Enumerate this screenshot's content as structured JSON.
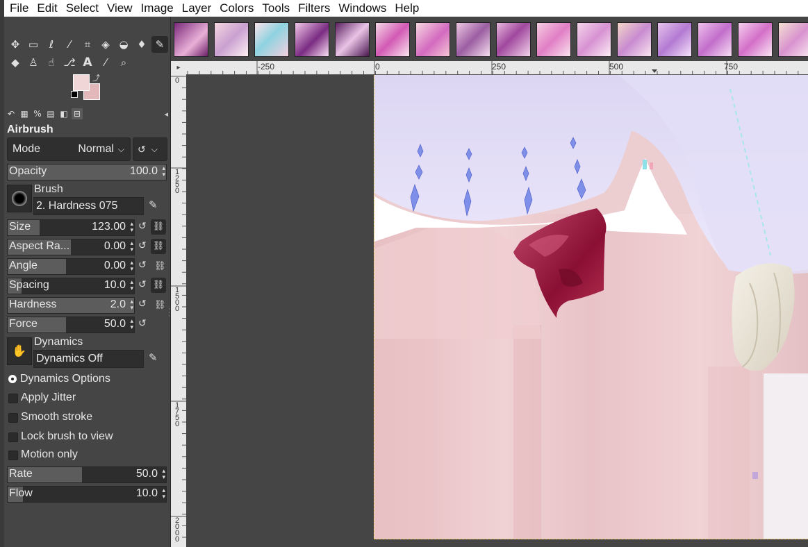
{
  "menubar": {
    "items": [
      "File",
      "Edit",
      "Select",
      "View",
      "Image",
      "Layer",
      "Colors",
      "Tools",
      "Filters",
      "Windows",
      "Help"
    ]
  },
  "toolbox": {
    "tools_row1": [
      "move-tool-icon",
      "rect-select-icon",
      "free-select-icon",
      "fuzzy-select-icon",
      "crop-icon",
      "transform-icon",
      "warp-icon",
      "bucket-fill-icon",
      "airbrush-icon"
    ],
    "tools_row2": [
      "eraser-icon",
      "clone-icon",
      "smudge-icon",
      "paths-icon",
      "text-icon",
      "color-picker-icon",
      "zoom-icon"
    ],
    "foreground_color": "#f1d6d8",
    "background_color": "#e2b8ba"
  },
  "tool_options": {
    "title": "Airbrush",
    "mode_label": "Mode",
    "mode_value": "Normal",
    "opacity": {
      "label": "Opacity",
      "value": "100.0"
    },
    "brush": {
      "label": "Brush",
      "value": "2. Hardness 075"
    },
    "size": {
      "label": "Size",
      "value": "123.00"
    },
    "aspect_ratio": {
      "label": "Aspect Ra...",
      "value": "0.00"
    },
    "angle": {
      "label": "Angle",
      "value": "0.00"
    },
    "spacing": {
      "label": "Spacing",
      "value": "10.0"
    },
    "hardness": {
      "label": "Hardness",
      "value": "2.0"
    },
    "force": {
      "label": "Force",
      "value": "50.0"
    },
    "dynamics": {
      "label": "Dynamics",
      "value": "Dynamics Off"
    },
    "dynamics_options": "Dynamics Options",
    "apply_jitter": "Apply Jitter",
    "smooth_stroke": "Smooth stroke",
    "lock_brush": "Lock brush to view",
    "motion_only": "Motion only",
    "rate": {
      "label": "Rate",
      "value": "50.0"
    },
    "flow": {
      "label": "Flow",
      "value": "10.0"
    }
  },
  "ruler": {
    "h_labels": [
      "-250",
      "0",
      "250",
      "500",
      "750"
    ],
    "v_labels": [
      "0",
      "1250",
      "1500",
      "1750",
      "2000"
    ]
  }
}
